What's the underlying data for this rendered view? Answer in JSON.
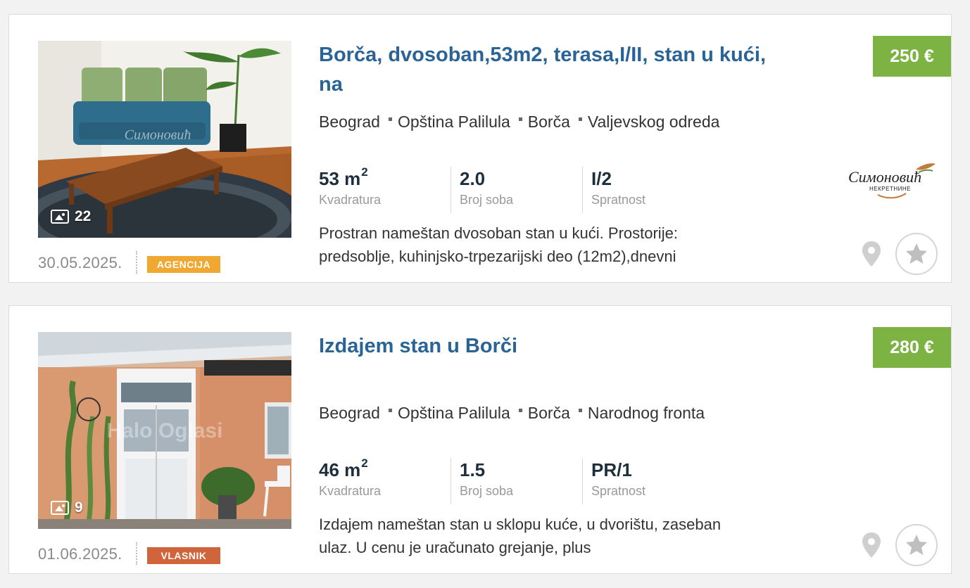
{
  "listings": [
    {
      "title": "Borča, dvosoban,53m2, terasa,I/II, stan u kući, na",
      "price": "250 €",
      "location": [
        "Beograd",
        "Opština Palilula",
        "Borča",
        "Valjevskog odreda"
      ],
      "features": [
        {
          "value": "53 m",
          "sup": "2",
          "label": "Kvadratura"
        },
        {
          "value": "2.0",
          "sup": "",
          "label": "Broj soba"
        },
        {
          "value": "I/2",
          "sup": "",
          "label": "Spratnost"
        }
      ],
      "description": "Prostran nameštan dvosoban stan u kući. Prostorije: predsoblje, kuhinjsko-trpezarijski deo (12m2),dnevni",
      "photo_count": "22",
      "date": "30.05.2025.",
      "badge": "AGENCIJA",
      "badge_color": "#f0a830",
      "agency_logo_text": "Симоновић",
      "agency_logo_subtext": "НЕКРЕТНИНЕ",
      "watermark": "Симоновић"
    },
    {
      "title": "Izdajem stan u Borči",
      "price": "280 €",
      "location": [
        "Beograd",
        "Opština Palilula",
        "Borča",
        "Narodnog fronta"
      ],
      "features": [
        {
          "value": "46 m",
          "sup": "2",
          "label": "Kvadratura"
        },
        {
          "value": "1.5",
          "sup": "",
          "label": "Broj soba"
        },
        {
          "value": "PR/1",
          "sup": "",
          "label": "Spratnost"
        }
      ],
      "description": "Izdajem nameštan stan u sklopu kuće, u dvorištu, zaseban ulaz. U cenu je uračunato grejanje, plus",
      "photo_count": "9",
      "date": "01.06.2025.",
      "badge": "VLASNIK",
      "badge_color": "#d0643a",
      "watermark": "Halo Oglasi"
    }
  ],
  "colors": {
    "title": "#2a6496",
    "price_bg": "#7cb342",
    "muted": "#999999"
  }
}
